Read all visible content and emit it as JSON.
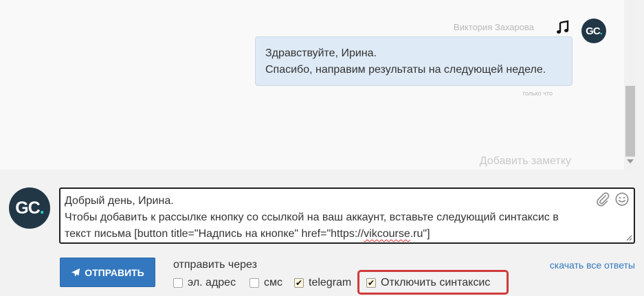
{
  "conversation": {
    "sender_name": "Виктория Захарова",
    "avatar_initials": "GC",
    "avatar_dot": ".",
    "message_lines": [
      "Здравствуйте, Ирина.",
      "Спасибо, направим результаты на следующей неделе."
    ],
    "message_time": "только что",
    "add_note": "Добавить заметку"
  },
  "composer": {
    "reply_lines": [
      "Добрый день, Ирина.",
      "Чтобы добавить к рассылке кнопку со ссылкой на ваш аккаунт, вставьте следующий синтаксис в"
    ],
    "reply_line3_before": "текст письма [button title=\"Надпись на кнопке\" href=\"https://",
    "reply_line3_underlined": "vikcourse",
    "reply_line3_after": ".ru\"]",
    "send_label": "ОТПРАВИТЬ",
    "send_via_label": "отправить через",
    "download_label": "скачать все ответы",
    "options": {
      "email": {
        "label": "эл. адрес",
        "checked": false
      },
      "sms": {
        "label": "смс",
        "checked": false
      },
      "telegram": {
        "label": "telegram",
        "checked": true
      },
      "disable_syntax": {
        "label": "Отключить синтаксис",
        "checked": true
      }
    }
  },
  "icons": {
    "music": "music-note-icon",
    "attach": "paperclip-icon",
    "emoji": "smiley-icon",
    "send": "paper-plane-icon"
  },
  "colors": {
    "avatar_bg": "#223746",
    "avatar_accent": "#1fd6c7",
    "bubble_bg": "#deeaf5",
    "primary": "#3378bf",
    "highlight": "#d03a3a"
  }
}
